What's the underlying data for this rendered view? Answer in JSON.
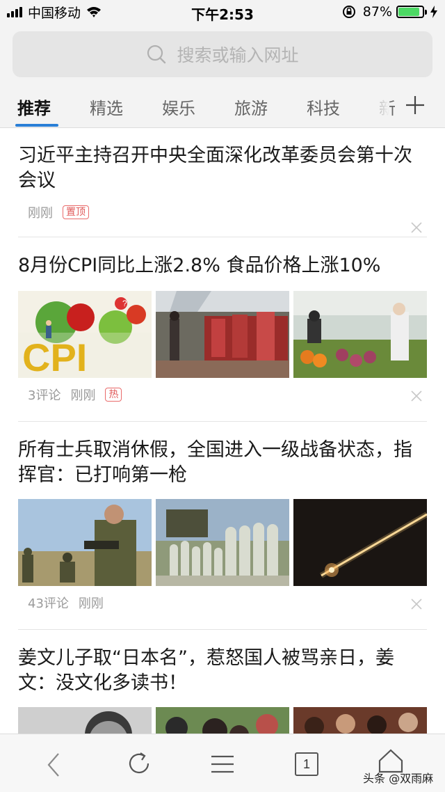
{
  "status_bar": {
    "carrier": "中国移动",
    "time": "下午2:53",
    "battery_percent": "87%",
    "battery_level": 0.87
  },
  "search": {
    "placeholder": "搜索或输入网址"
  },
  "tabs": [
    {
      "label": "推荐",
      "active": true
    },
    {
      "label": "精选",
      "active": false
    },
    {
      "label": "娱乐",
      "active": false
    },
    {
      "label": "旅游",
      "active": false
    },
    {
      "label": "科技",
      "active": false
    },
    {
      "label": "新",
      "active": false
    }
  ],
  "articles": [
    {
      "title": "习近平主持召开中央全面深化改革委员会第十次会议",
      "comments": "",
      "time": "刚刚",
      "badge": "置顶"
    },
    {
      "title": "8月份CPI同比上涨2.8% 食品价格上涨10%",
      "comments": "3评论",
      "time": "刚刚",
      "badge": "热"
    },
    {
      "title": "所有士兵取消休假，全国进入一级战备状态，指挥官：已打响第一枪",
      "comments": "43评论",
      "time": "刚刚",
      "badge": ""
    },
    {
      "title": "姜文儿子取“日本名”，惹怒国人被骂亲日，姜文：没文化多读书！",
      "comments": "",
      "time": "",
      "badge": ""
    }
  ],
  "cpi_thumb_text": "CPI",
  "bottom_bar": {
    "tab_count": "1",
    "watermark": "头条 @双雨麻"
  },
  "colors": {
    "accent": "#2a7fd6",
    "badge_red": "#e05a5a",
    "battery_green": "#4cd964"
  }
}
